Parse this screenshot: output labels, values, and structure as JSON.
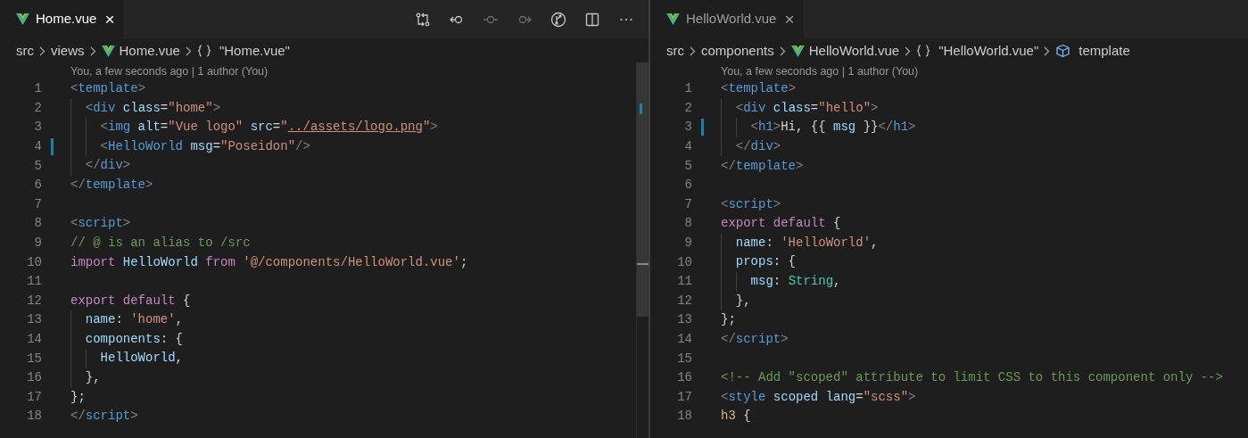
{
  "panes": [
    {
      "focused": true,
      "tab": {
        "label": "Home.vue",
        "close": "×"
      },
      "toolbar": [
        {
          "kind": "compare",
          "disabled": false
        },
        {
          "kind": "back",
          "disabled": false
        },
        {
          "kind": "commit",
          "disabled": true
        },
        {
          "kind": "forward",
          "disabled": true
        },
        {
          "kind": "graph",
          "disabled": false
        },
        {
          "kind": "split",
          "disabled": false
        },
        {
          "kind": "more",
          "disabled": false
        }
      ],
      "breadcrumbs": [
        {
          "kind": "folder",
          "label": "src"
        },
        {
          "kind": "folder",
          "label": "views"
        },
        {
          "kind": "vue",
          "label": "Home.vue"
        },
        {
          "kind": "object",
          "label": "\"Home.vue\""
        }
      ],
      "codelens": "You, a few seconds ago | 1 author (You)",
      "scrollbar": true,
      "lines": [
        {
          "n": "1",
          "changed": false,
          "t": [
            {
              "kind": "p",
              "text": "<"
            },
            {
              "kind": "tn",
              "text": "template"
            },
            {
              "kind": "p",
              "text": ">"
            }
          ]
        },
        {
          "n": "2",
          "changed": false,
          "t": [
            {
              "kind": "p",
              "text": "  <"
            },
            {
              "kind": "tn",
              "text": "div"
            },
            {
              "kind": "attr",
              "text": " class"
            },
            {
              "kind": "plain",
              "text": "="
            },
            {
              "kind": "str",
              "text": "\"home\""
            },
            {
              "kind": "p",
              "text": ">"
            }
          ]
        },
        {
          "n": "3",
          "changed": false,
          "t": [
            {
              "kind": "p",
              "text": "    <"
            },
            {
              "kind": "tn",
              "text": "img"
            },
            {
              "kind": "attr",
              "text": " alt"
            },
            {
              "kind": "plain",
              "text": "="
            },
            {
              "kind": "str",
              "text": "\"Vue logo\""
            },
            {
              "kind": "attr",
              "text": " src"
            },
            {
              "kind": "plain",
              "text": "="
            },
            {
              "kind": "str",
              "text": "\""
            },
            {
              "kind": "link",
              "text": "../assets/logo.png"
            },
            {
              "kind": "str",
              "text": "\""
            },
            {
              "kind": "p",
              "text": ">"
            }
          ]
        },
        {
          "n": "4",
          "changed": true,
          "t": [
            {
              "kind": "p",
              "text": "    <"
            },
            {
              "kind": "tn",
              "text": "HelloWorld"
            },
            {
              "kind": "attr",
              "text": " msg"
            },
            {
              "kind": "plain",
              "text": "="
            },
            {
              "kind": "str",
              "text": "\"Poseidon\""
            },
            {
              "kind": "p",
              "text": "/>"
            }
          ]
        },
        {
          "n": "5",
          "changed": false,
          "t": [
            {
              "kind": "p",
              "text": "  </"
            },
            {
              "kind": "tn",
              "text": "div"
            },
            {
              "kind": "p",
              "text": ">"
            }
          ]
        },
        {
          "n": "6",
          "changed": false,
          "t": [
            {
              "kind": "p",
              "text": "</"
            },
            {
              "kind": "tn",
              "text": "template"
            },
            {
              "kind": "p",
              "text": ">"
            }
          ]
        },
        {
          "n": "7",
          "changed": false
        },
        {
          "n": "8",
          "changed": false,
          "t": [
            {
              "kind": "p",
              "text": "<"
            },
            {
              "kind": "tn",
              "text": "script"
            },
            {
              "kind": "p",
              "text": ">"
            }
          ]
        },
        {
          "n": "9",
          "changed": false,
          "t": [
            {
              "kind": "comment",
              "text": "// @ is an alias to /src"
            }
          ]
        },
        {
          "n": "10",
          "changed": false,
          "t": [
            {
              "kind": "kw",
              "text": "import"
            },
            {
              "kind": "attr",
              "text": " HelloWorld"
            },
            {
              "kind": "kw",
              "text": " from"
            },
            {
              "kind": "str",
              "text": " '@/components/HelloWorld.vue'"
            },
            {
              "kind": "plain",
              "text": ";"
            }
          ]
        },
        {
          "n": "11",
          "changed": false
        },
        {
          "n": "12",
          "changed": false,
          "t": [
            {
              "kind": "kw",
              "text": "export default"
            },
            {
              "kind": "plain",
              "text": " {"
            }
          ]
        },
        {
          "n": "13",
          "changed": false,
          "t": [
            {
              "kind": "attr",
              "text": "  name"
            },
            {
              "kind": "plain",
              "text": ": "
            },
            {
              "kind": "str",
              "text": "'home'"
            },
            {
              "kind": "plain",
              "text": ","
            }
          ]
        },
        {
          "n": "14",
          "changed": false,
          "t": [
            {
              "kind": "attr",
              "text": "  components"
            },
            {
              "kind": "plain",
              "text": ": {"
            }
          ]
        },
        {
          "n": "15",
          "changed": false,
          "t": [
            {
              "kind": "attr",
              "text": "    HelloWorld"
            },
            {
              "kind": "plain",
              "text": ","
            }
          ]
        },
        {
          "n": "16",
          "changed": false,
          "t": [
            {
              "kind": "plain",
              "text": "  },"
            }
          ]
        },
        {
          "n": "17",
          "changed": false,
          "t": [
            {
              "kind": "plain",
              "text": "};"
            }
          ]
        },
        {
          "n": "18",
          "changed": false,
          "t": [
            {
              "kind": "p",
              "text": "</"
            },
            {
              "kind": "tn",
              "text": "script"
            },
            {
              "kind": "p",
              "text": ">"
            }
          ]
        }
      ]
    },
    {
      "focused": false,
      "tab": {
        "label": "HelloWorld.vue",
        "close": "×"
      },
      "breadcrumbs": [
        {
          "kind": "folder",
          "label": "src"
        },
        {
          "kind": "folder",
          "label": "components"
        },
        {
          "kind": "vue",
          "label": "HelloWorld.vue"
        },
        {
          "kind": "object",
          "label": "\"HelloWorld.vue\""
        },
        {
          "kind": "element",
          "label": "template"
        }
      ],
      "codelens": "You, a few seconds ago | 1 author (You)",
      "lines": [
        {
          "n": "1",
          "changed": false,
          "t": [
            {
              "kind": "p",
              "text": "<"
            },
            {
              "kind": "tn",
              "text": "template"
            },
            {
              "kind": "p",
              "text": ">"
            }
          ]
        },
        {
          "n": "2",
          "changed": false,
          "t": [
            {
              "kind": "p",
              "text": "  <"
            },
            {
              "kind": "tn",
              "text": "div"
            },
            {
              "kind": "attr",
              "text": " class"
            },
            {
              "kind": "plain",
              "text": "="
            },
            {
              "kind": "str",
              "text": "\"hello\""
            },
            {
              "kind": "p",
              "text": ">"
            }
          ]
        },
        {
          "n": "3",
          "changed": true,
          "t": [
            {
              "kind": "p",
              "text": "    <"
            },
            {
              "kind": "tn",
              "text": "h1"
            },
            {
              "kind": "p",
              "text": ">"
            },
            {
              "kind": "plain",
              "text": "Hi, {{"
            },
            {
              "kind": "attr",
              "text": " msg "
            },
            {
              "kind": "plain",
              "text": "}}"
            },
            {
              "kind": "p",
              "text": "</"
            },
            {
              "kind": "tn",
              "text": "h1"
            },
            {
              "kind": "p",
              "text": ">"
            }
          ]
        },
        {
          "n": "4",
          "changed": false,
          "t": [
            {
              "kind": "p",
              "text": "  </"
            },
            {
              "kind": "tn",
              "text": "div"
            },
            {
              "kind": "p",
              "text": ">"
            }
          ]
        },
        {
          "n": "5",
          "changed": false,
          "t": [
            {
              "kind": "p",
              "text": "</"
            },
            {
              "kind": "tn",
              "text": "template"
            },
            {
              "kind": "p",
              "text": ">"
            }
          ]
        },
        {
          "n": "6",
          "changed": false
        },
        {
          "n": "7",
          "changed": false,
          "t": [
            {
              "kind": "p",
              "text": "<"
            },
            {
              "kind": "tn",
              "text": "script"
            },
            {
              "kind": "p",
              "text": ">"
            }
          ]
        },
        {
          "n": "8",
          "changed": false,
          "t": [
            {
              "kind": "kw",
              "text": "export default"
            },
            {
              "kind": "plain",
              "text": " {"
            }
          ]
        },
        {
          "n": "9",
          "changed": false,
          "t": [
            {
              "kind": "attr",
              "text": "  name"
            },
            {
              "kind": "plain",
              "text": ": "
            },
            {
              "kind": "str",
              "text": "'HelloWorld'"
            },
            {
              "kind": "plain",
              "text": ","
            }
          ]
        },
        {
          "n": "10",
          "changed": false,
          "t": [
            {
              "kind": "attr",
              "text": "  props"
            },
            {
              "kind": "plain",
              "text": ": {"
            }
          ]
        },
        {
          "n": "11",
          "changed": false,
          "t": [
            {
              "kind": "attr",
              "text": "    msg"
            },
            {
              "kind": "plain",
              "text": ": "
            },
            {
              "kind": "type",
              "text": "String"
            },
            {
              "kind": "plain",
              "text": ","
            }
          ]
        },
        {
          "n": "12",
          "changed": false,
          "t": [
            {
              "kind": "plain",
              "text": "  },"
            }
          ]
        },
        {
          "n": "13",
          "changed": false,
          "t": [
            {
              "kind": "plain",
              "text": "};"
            }
          ]
        },
        {
          "n": "14",
          "changed": false,
          "t": [
            {
              "kind": "p",
              "text": "</"
            },
            {
              "kind": "tn",
              "text": "script"
            },
            {
              "kind": "p",
              "text": ">"
            }
          ]
        },
        {
          "n": "15",
          "changed": false
        },
        {
          "n": "16",
          "changed": false,
          "t": [
            {
              "kind": "comment",
              "text": "<!-- Add \"scoped\" attribute to limit CSS to this component only -->"
            }
          ]
        },
        {
          "n": "17",
          "changed": false,
          "t": [
            {
              "kind": "p",
              "text": "<"
            },
            {
              "kind": "tn",
              "text": "style"
            },
            {
              "kind": "attr",
              "text": " scoped lang"
            },
            {
              "kind": "plain",
              "text": "="
            },
            {
              "kind": "str",
              "text": "\"scss\""
            },
            {
              "kind": "p",
              "text": ">"
            }
          ]
        },
        {
          "n": "18",
          "changed": false,
          "t": [
            {
              "kind": "sel",
              "text": "h3"
            },
            {
              "kind": "plain",
              "text": " {"
            }
          ]
        }
      ]
    }
  ]
}
